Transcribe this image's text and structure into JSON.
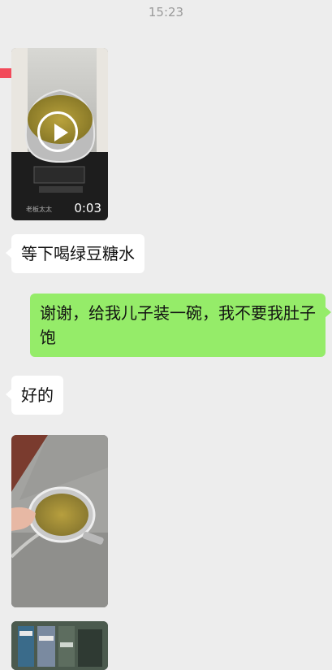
{
  "chat": {
    "timestamp": "15:23",
    "messages": [
      {
        "type": "video",
        "duration": "0:03",
        "watermark": "老板太太"
      },
      {
        "type": "text",
        "side": "left",
        "text": "等下喝绿豆糖水"
      },
      {
        "type": "text",
        "side": "right",
        "text": "谢谢，给我儿子装一碗，我不要我肚子饱"
      },
      {
        "type": "text",
        "side": "left",
        "text": "好的"
      },
      {
        "type": "image"
      },
      {
        "type": "image"
      }
    ]
  }
}
